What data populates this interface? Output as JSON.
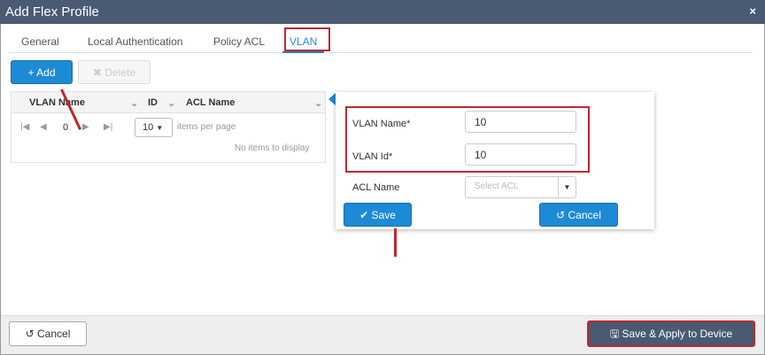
{
  "dialog": {
    "title": "Add Flex Profile",
    "close_icon": "×"
  },
  "tabs": [
    {
      "label": "General"
    },
    {
      "label": "Local Authentication"
    },
    {
      "label": "Policy ACL"
    },
    {
      "label": "VLAN",
      "active": true
    }
  ],
  "toolbar": {
    "add_label": "Add",
    "delete_label": "Delete"
  },
  "grid": {
    "columns": [
      "VLAN Name",
      "ID",
      "ACL Name"
    ],
    "page": "0",
    "page_size": "10",
    "items_per_page": "items per page",
    "empty": "No items to display"
  },
  "form": {
    "vlan_name_label": "VLAN Name*",
    "vlan_name_value": "10",
    "vlan_id_label": "VLAN Id*",
    "vlan_id_value": "10",
    "acl_label": "ACL Name",
    "acl_placeholder": "Select ACL",
    "save_label": "Save",
    "cancel_label": "Cancel"
  },
  "footer": {
    "cancel_label": "Cancel",
    "apply_label": "Save & Apply to Device"
  },
  "colors": {
    "accent": "#1d8ad6",
    "highlight": "#c0282d",
    "titlebar": "#4a5a72"
  }
}
